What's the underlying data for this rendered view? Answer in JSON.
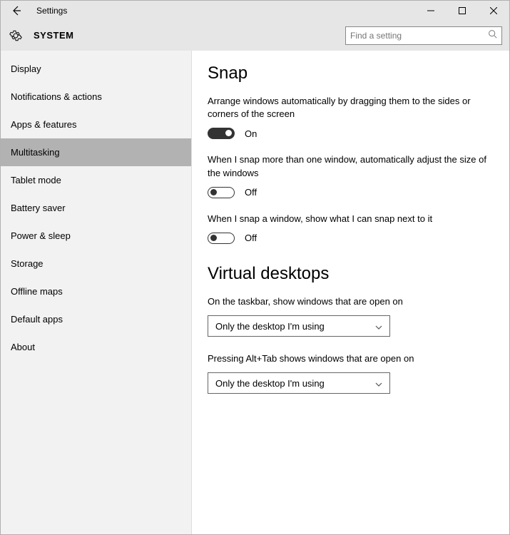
{
  "titlebar": {
    "title": "Settings"
  },
  "header": {
    "section": "SYSTEM",
    "search_placeholder": "Find a setting"
  },
  "sidebar": {
    "items": [
      {
        "label": "Display"
      },
      {
        "label": "Notifications & actions"
      },
      {
        "label": "Apps & features"
      },
      {
        "label": "Multitasking"
      },
      {
        "label": "Tablet mode"
      },
      {
        "label": "Battery saver"
      },
      {
        "label": "Power & sleep"
      },
      {
        "label": "Storage"
      },
      {
        "label": "Offline maps"
      },
      {
        "label": "Default apps"
      },
      {
        "label": "About"
      }
    ],
    "selected_index": 3
  },
  "content": {
    "snap": {
      "heading": "Snap",
      "option1": {
        "desc": "Arrange windows automatically by dragging them to the sides or corners of the screen",
        "state": "On"
      },
      "option2": {
        "desc": "When I snap more than one window, automatically adjust the size of the windows",
        "state": "Off"
      },
      "option3": {
        "desc": "When I snap a window, show what I can snap next to it",
        "state": "Off"
      }
    },
    "virtual_desktops": {
      "heading": "Virtual desktops",
      "option1": {
        "desc": "On the taskbar, show windows that are open on",
        "value": "Only the desktop I'm using"
      },
      "option2": {
        "desc": "Pressing Alt+Tab shows windows that are open on",
        "value": "Only the desktop I'm using"
      }
    }
  }
}
